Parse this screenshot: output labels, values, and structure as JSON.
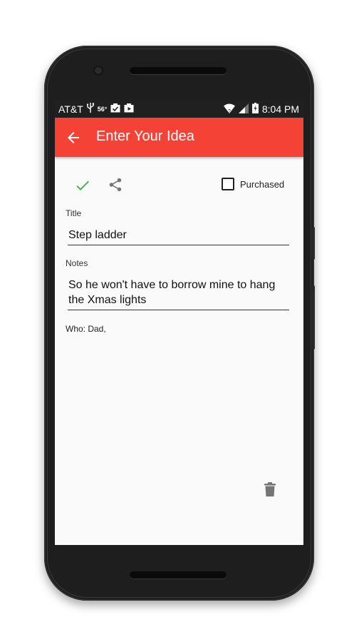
{
  "status_bar": {
    "carrier": "AT&T",
    "temperature": "56°",
    "time": "8:04 PM"
  },
  "app_bar": {
    "title": "Enter Your Idea"
  },
  "toolbar": {
    "purchased_label": "Purchased",
    "purchased_checked": false
  },
  "form": {
    "title_label": "Title",
    "title_value": "Step ladder",
    "notes_label": "Notes",
    "notes_value": "So he won't have to borrow mine to hang the Xmas lights",
    "who_text": "Who: Dad,"
  },
  "colors": {
    "accent": "#f44336",
    "check": "#4caf50",
    "icon_gray": "#757575"
  },
  "icons": [
    "back-arrow-icon",
    "check-icon",
    "share-icon",
    "checkbox-icon",
    "trash-icon",
    "usb-icon",
    "wifi-icon",
    "signal-icon",
    "battery-icon"
  ]
}
